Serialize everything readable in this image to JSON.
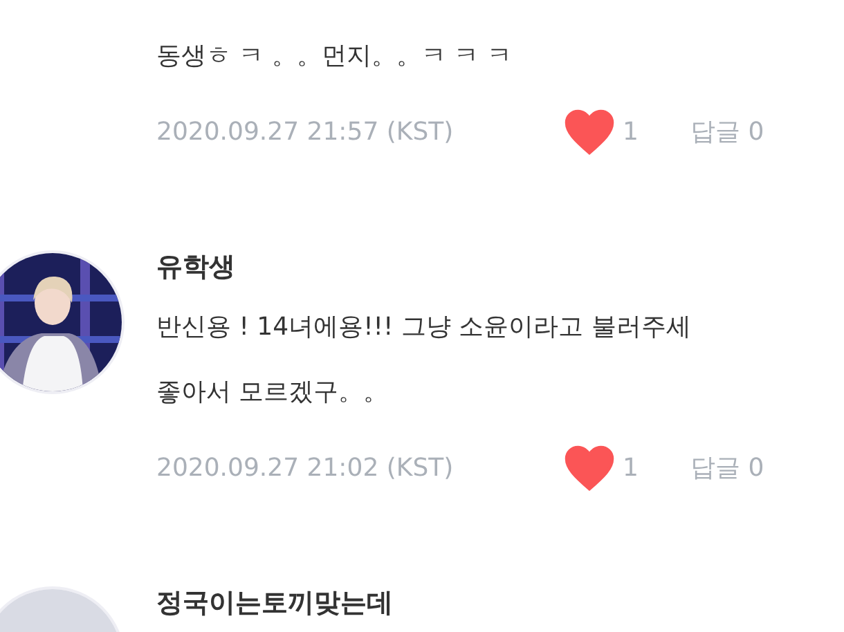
{
  "comments": [
    {
      "body_lines": [
        "동생ㅎ ㅋ 。。먼지。。ㅋ ㅋ ㅋ"
      ],
      "date": "2020.09.27 21:57 (KST)",
      "liked": true,
      "likes": "1",
      "replies": "답글 0"
    },
    {
      "avatar": {
        "kind": "picture"
      },
      "name": "유학생",
      "body_lines": [
        "반신용 ! 14녀에용!!! 그냥 소윤이라고 불러주세",
        "좋아서 모르겠구。。"
      ],
      "date": "2020.09.27 21:02 (KST)",
      "liked": true,
      "likes": "1",
      "replies": "답글 0"
    },
    {
      "avatar": {
        "kind": "picture"
      },
      "name": "정국이는토끼맞는데"
    }
  ]
}
